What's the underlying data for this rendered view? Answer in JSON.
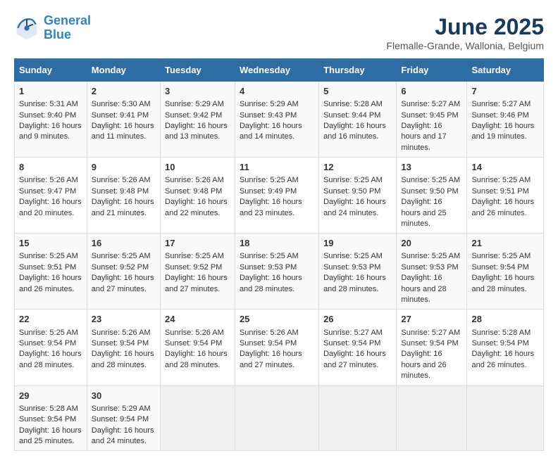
{
  "header": {
    "logo_line1": "General",
    "logo_line2": "Blue",
    "title": "June 2025",
    "subtitle": "Flemalle-Grande, Wallonia, Belgium"
  },
  "columns": [
    "Sunday",
    "Monday",
    "Tuesday",
    "Wednesday",
    "Thursday",
    "Friday",
    "Saturday"
  ],
  "weeks": [
    [
      {
        "day": "1",
        "sunrise": "Sunrise: 5:31 AM",
        "sunset": "Sunset: 9:40 PM",
        "daylight": "Daylight: 16 hours and 9 minutes."
      },
      {
        "day": "2",
        "sunrise": "Sunrise: 5:30 AM",
        "sunset": "Sunset: 9:41 PM",
        "daylight": "Daylight: 16 hours and 11 minutes."
      },
      {
        "day": "3",
        "sunrise": "Sunrise: 5:29 AM",
        "sunset": "Sunset: 9:42 PM",
        "daylight": "Daylight: 16 hours and 13 minutes."
      },
      {
        "day": "4",
        "sunrise": "Sunrise: 5:29 AM",
        "sunset": "Sunset: 9:43 PM",
        "daylight": "Daylight: 16 hours and 14 minutes."
      },
      {
        "day": "5",
        "sunrise": "Sunrise: 5:28 AM",
        "sunset": "Sunset: 9:44 PM",
        "daylight": "Daylight: 16 hours and 16 minutes."
      },
      {
        "day": "6",
        "sunrise": "Sunrise: 5:27 AM",
        "sunset": "Sunset: 9:45 PM",
        "daylight": "Daylight: 16 hours and 17 minutes."
      },
      {
        "day": "7",
        "sunrise": "Sunrise: 5:27 AM",
        "sunset": "Sunset: 9:46 PM",
        "daylight": "Daylight: 16 hours and 19 minutes."
      }
    ],
    [
      {
        "day": "8",
        "sunrise": "Sunrise: 5:26 AM",
        "sunset": "Sunset: 9:47 PM",
        "daylight": "Daylight: 16 hours and 20 minutes."
      },
      {
        "day": "9",
        "sunrise": "Sunrise: 5:26 AM",
        "sunset": "Sunset: 9:48 PM",
        "daylight": "Daylight: 16 hours and 21 minutes."
      },
      {
        "day": "10",
        "sunrise": "Sunrise: 5:26 AM",
        "sunset": "Sunset: 9:48 PM",
        "daylight": "Daylight: 16 hours and 22 minutes."
      },
      {
        "day": "11",
        "sunrise": "Sunrise: 5:25 AM",
        "sunset": "Sunset: 9:49 PM",
        "daylight": "Daylight: 16 hours and 23 minutes."
      },
      {
        "day": "12",
        "sunrise": "Sunrise: 5:25 AM",
        "sunset": "Sunset: 9:50 PM",
        "daylight": "Daylight: 16 hours and 24 minutes."
      },
      {
        "day": "13",
        "sunrise": "Sunrise: 5:25 AM",
        "sunset": "Sunset: 9:50 PM",
        "daylight": "Daylight: 16 hours and 25 minutes."
      },
      {
        "day": "14",
        "sunrise": "Sunrise: 5:25 AM",
        "sunset": "Sunset: 9:51 PM",
        "daylight": "Daylight: 16 hours and 26 minutes."
      }
    ],
    [
      {
        "day": "15",
        "sunrise": "Sunrise: 5:25 AM",
        "sunset": "Sunset: 9:51 PM",
        "daylight": "Daylight: 16 hours and 26 minutes."
      },
      {
        "day": "16",
        "sunrise": "Sunrise: 5:25 AM",
        "sunset": "Sunset: 9:52 PM",
        "daylight": "Daylight: 16 hours and 27 minutes."
      },
      {
        "day": "17",
        "sunrise": "Sunrise: 5:25 AM",
        "sunset": "Sunset: 9:52 PM",
        "daylight": "Daylight: 16 hours and 27 minutes."
      },
      {
        "day": "18",
        "sunrise": "Sunrise: 5:25 AM",
        "sunset": "Sunset: 9:53 PM",
        "daylight": "Daylight: 16 hours and 28 minutes."
      },
      {
        "day": "19",
        "sunrise": "Sunrise: 5:25 AM",
        "sunset": "Sunset: 9:53 PM",
        "daylight": "Daylight: 16 hours and 28 minutes."
      },
      {
        "day": "20",
        "sunrise": "Sunrise: 5:25 AM",
        "sunset": "Sunset: 9:53 PM",
        "daylight": "Daylight: 16 hours and 28 minutes."
      },
      {
        "day": "21",
        "sunrise": "Sunrise: 5:25 AM",
        "sunset": "Sunset: 9:54 PM",
        "daylight": "Daylight: 16 hours and 28 minutes."
      }
    ],
    [
      {
        "day": "22",
        "sunrise": "Sunrise: 5:25 AM",
        "sunset": "Sunset: 9:54 PM",
        "daylight": "Daylight: 16 hours and 28 minutes."
      },
      {
        "day": "23",
        "sunrise": "Sunrise: 5:26 AM",
        "sunset": "Sunset: 9:54 PM",
        "daylight": "Daylight: 16 hours and 28 minutes."
      },
      {
        "day": "24",
        "sunrise": "Sunrise: 5:26 AM",
        "sunset": "Sunset: 9:54 PM",
        "daylight": "Daylight: 16 hours and 28 minutes."
      },
      {
        "day": "25",
        "sunrise": "Sunrise: 5:26 AM",
        "sunset": "Sunset: 9:54 PM",
        "daylight": "Daylight: 16 hours and 27 minutes."
      },
      {
        "day": "26",
        "sunrise": "Sunrise: 5:27 AM",
        "sunset": "Sunset: 9:54 PM",
        "daylight": "Daylight: 16 hours and 27 minutes."
      },
      {
        "day": "27",
        "sunrise": "Sunrise: 5:27 AM",
        "sunset": "Sunset: 9:54 PM",
        "daylight": "Daylight: 16 hours and 26 minutes."
      },
      {
        "day": "28",
        "sunrise": "Sunrise: 5:28 AM",
        "sunset": "Sunset: 9:54 PM",
        "daylight": "Daylight: 16 hours and 26 minutes."
      }
    ],
    [
      {
        "day": "29",
        "sunrise": "Sunrise: 5:28 AM",
        "sunset": "Sunset: 9:54 PM",
        "daylight": "Daylight: 16 hours and 25 minutes."
      },
      {
        "day": "30",
        "sunrise": "Sunrise: 5:29 AM",
        "sunset": "Sunset: 9:54 PM",
        "daylight": "Daylight: 16 hours and 24 minutes."
      },
      null,
      null,
      null,
      null,
      null
    ]
  ]
}
